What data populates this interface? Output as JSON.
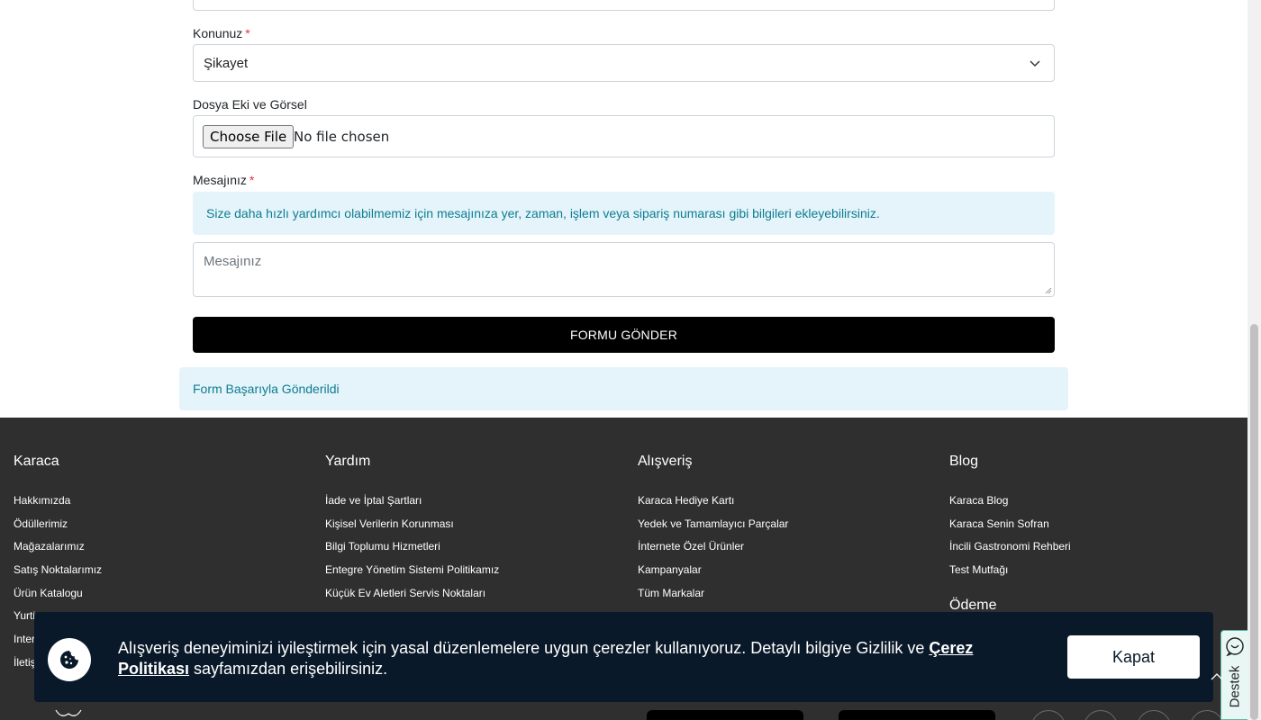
{
  "form": {
    "subject_label": "Konunuz",
    "required_mark": "*",
    "subject_value": "Şikayet",
    "attachment_label": "Dosya Eki ve Görsel",
    "file_button": "Choose File",
    "file_status": "No file chosen",
    "message_label": "Mesajınız",
    "message_hint": "Size daha hızlı yardımcı olabilmemiz için mesajınıza yer, zaman, işlem veya sipariş numarası gibi bilgileri ekleyebilirsiniz.",
    "message_placeholder": "Mesajınız",
    "submit_label": "FORMU GÖNDER",
    "success_message": "Form Başarıyla Gönderildi"
  },
  "footer": {
    "columns": [
      {
        "title": "Karaca",
        "links": [
          "Hakkımızda",
          "Ödüllerimiz",
          "Mağazalarımız",
          "Satış Noktalarımız",
          "Ürün Katalogu",
          "Yurti",
          "Inter",
          "İletiş"
        ]
      },
      {
        "title": "Yardım",
        "links": [
          "İade ve İptal Şartları",
          "Kişisel Verilerin Korunması",
          "Bilgi Toplumu Hizmetleri",
          "Entegre Yönetim Sistemi Politikamız",
          "Küçük Ev Aletleri Servis Noktaları"
        ]
      },
      {
        "title": "Alışveriş",
        "links": [
          "Karaca Hediye Kartı",
          "Yedek ve Tamamlayıcı Parçalar",
          "İnternete Özel Ürünler",
          "Kampanyalar",
          "Tüm Markalar"
        ]
      },
      {
        "title": "Blog",
        "links": [
          "Karaca Blog",
          "Karaca Senin Sofran",
          "İncili Gastronomi Rehberi",
          "Test Mutfağı"
        ]
      }
    ],
    "payment_title": "Ödeme"
  },
  "cookie": {
    "text_before": "Alışveriş deneyiminizi iyileştirmek için yasal düzenlemelere uygun çerezler kullanıyoruz. Detaylı bilgiye Gizlilik ve ",
    "link_text": "Çerez Politikası",
    "text_after": " sayfamızdan erişebilirsiniz.",
    "close_label": "Kapat"
  },
  "support": {
    "label": "Destek"
  },
  "icons": {
    "cookie": "cookie-icon",
    "chevron": "chevron-down-icon",
    "support": "chat-support-icon"
  }
}
